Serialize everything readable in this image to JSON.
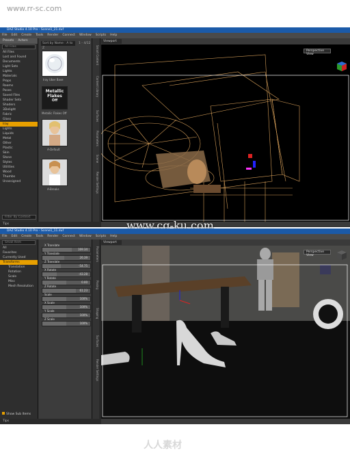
{
  "watermarks": {
    "top": "www.rr-sc.com",
    "middle": "www.cg-ku.com",
    "bottom_logo": "人人素材"
  },
  "top_window": {
    "title": "DAZ Studio 4.10 Pro - Scene1_21.duf",
    "menu": [
      "File",
      "Edit",
      "Create",
      "Tools",
      "Render",
      "Connect",
      "Window",
      "Scripts",
      "Help"
    ],
    "left_tabs": [
      "Presets",
      "Actors"
    ],
    "left_dropdown": "All Files",
    "folders": [
      "All Files",
      "Lost and Found",
      "Documents",
      "Light Sets",
      "Lights",
      "Materials",
      "Props",
      "Rooms",
      "Poses",
      "Saved Files",
      "Shader Sets",
      "Shaders",
      "3Delight",
      "Fabric",
      "Glass",
      "Iray",
      "Lights",
      "Liquids",
      "Metal",
      "Other",
      "Plastic",
      "Skin",
      "Stone",
      "Styles",
      "Utilities",
      "Wood",
      "Thumbs",
      "Unassigned"
    ],
    "selected_folder": "Iray",
    "filter_text": "Filter By Context",
    "mid_header": "Sort by Name : A to Z",
    "mid_count": "1 - 4/12",
    "thumbnails": [
      {
        "label": "Iray Uber Base",
        "thumb": "sphere"
      },
      {
        "label": "Metallic Flakes Off",
        "thumb": "metallic",
        "caption_lines": [
          "Metallic",
          "Flakes",
          "Off"
        ]
      },
      {
        "label": "A-Default",
        "thumb": "figure"
      },
      {
        "label": "A-Breaks",
        "thumb": "figure"
      }
    ],
    "side_vtabs": [
      "Smart Content",
      "Content Library",
      "Surfaces",
      "Parameters",
      "Scene",
      "Render Settings"
    ],
    "viewport_label": "Viewport",
    "view_dropdown": "Perspective View",
    "bottom_tab": "Tips"
  },
  "bottom_window": {
    "title": "DAZ Studio 4.10 Pro - Scene1_11.duf",
    "menu": [
      "File",
      "Edit",
      "Create",
      "Tools",
      "Render",
      "Connect",
      "Window",
      "Scripts",
      "Help"
    ],
    "left_dropdown": "Small Item",
    "tree": [
      "All",
      "Favorites",
      "Currently Used",
      "Transforms",
      "Translation",
      "Rotation",
      "Scale",
      "Misc",
      "Mesh Resolution"
    ],
    "selected_tree": "Transforms",
    "params": [
      {
        "label": "X Translate",
        "value": "169.34"
      },
      {
        "label": "Y Translate",
        "value": "26.39"
      },
      {
        "label": "Z Translate",
        "value": "-54.75"
      },
      {
        "label": "X Rotate",
        "value": "-43.28"
      },
      {
        "label": "Y Rotate",
        "value": "0.00"
      },
      {
        "label": "Z Rotate",
        "value": "61.23"
      },
      {
        "label": "Scale",
        "value": "100%"
      },
      {
        "label": "X Scale",
        "value": "100%"
      },
      {
        "label": "Y Scale",
        "value": "100%"
      },
      {
        "label": "Z Scale",
        "value": "100%"
      }
    ],
    "param_levels": [
      0.62,
      0.45,
      0.38,
      0.3,
      0.5,
      0.7,
      0.5,
      0.5,
      0.5,
      0.5
    ],
    "show_sub_items": "Show Sub Items",
    "side_vtabs": [
      "Parameters",
      "Posing",
      "Shaping",
      "Surfaces",
      "Render Settings"
    ],
    "viewport_label": "Viewport",
    "view_dropdown": "Perspective View",
    "bottom_tab": "Tips"
  },
  "colors": {
    "title_blue": "#1b5aa8",
    "selection_orange": "#e8a000",
    "wireframe_gold": "#d9a15a",
    "viewport_bg": "#000000"
  }
}
